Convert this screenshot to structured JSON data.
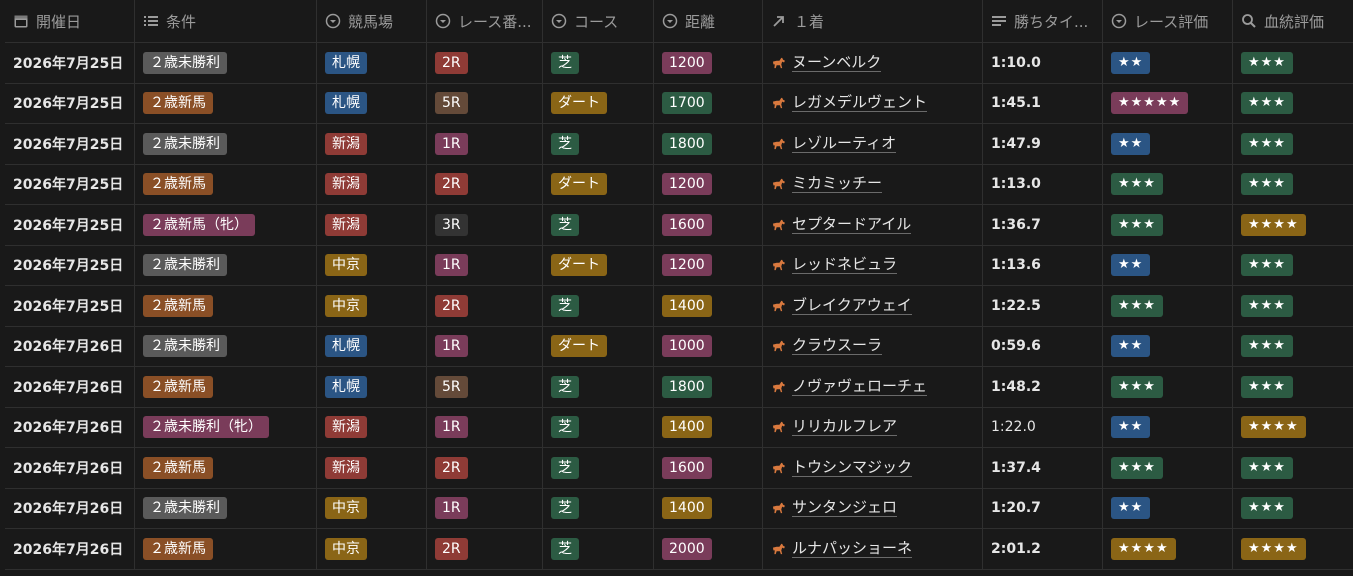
{
  "columns": [
    {
      "label": "開催日",
      "icon": "calendar-icon"
    },
    {
      "label": "条件",
      "icon": "list-icon"
    },
    {
      "label": "競馬場",
      "icon": "select-icon"
    },
    {
      "label": "レース番...",
      "icon": "select-icon"
    },
    {
      "label": "コース",
      "icon": "select-icon"
    },
    {
      "label": "距離",
      "icon": "select-icon"
    },
    {
      "label": "１着",
      "icon": "relation-arrow-icon"
    },
    {
      "label": "勝ちタイ...",
      "icon": "text-lines-icon"
    },
    {
      "label": "レース評価",
      "icon": "select-icon"
    },
    {
      "label": "血統評価",
      "icon": "search-icon"
    }
  ],
  "colors": {
    "background": "#191919",
    "border": "#2f2f2f",
    "gray": "#5a5a5a",
    "orange": "#8a4f26",
    "pink": "#7a3c5a",
    "blue": "#2b5584",
    "red": "#8f3b36",
    "yellow": "#8a6516",
    "brown": "#644a39",
    "dark": "#333333",
    "purple": "#6a3f73",
    "green": "#2c5b43"
  },
  "rows": [
    {
      "date": "2026年7月25日",
      "cond": "２歳未勝利",
      "condColor": "gray",
      "venue": "札幌",
      "venueColor": "blue",
      "race": "2R",
      "raceColor": "red",
      "course": "芝",
      "courseColor": "green",
      "dist": "1200",
      "distColor": "pink",
      "winner": "ヌーンベルク",
      "time": "1:10.0",
      "timeBold": true,
      "raceEval": "★★",
      "raceEvalColor": "blue",
      "bloodEval": "★★★",
      "bloodEvalColor": "green"
    },
    {
      "date": "2026年7月25日",
      "cond": "２歳新馬",
      "condColor": "orange",
      "venue": "札幌",
      "venueColor": "blue",
      "race": "5R",
      "raceColor": "brown",
      "course": "ダート",
      "courseColor": "yellow",
      "dist": "1700",
      "distColor": "green",
      "winner": "レガメデルヴェント",
      "time": "1:45.1",
      "timeBold": true,
      "raceEval": "★★★★★",
      "raceEvalColor": "pink",
      "bloodEval": "★★★",
      "bloodEvalColor": "green"
    },
    {
      "date": "2026年7月25日",
      "cond": "２歳未勝利",
      "condColor": "gray",
      "venue": "新潟",
      "venueColor": "red",
      "race": "1R",
      "raceColor": "pink",
      "course": "芝",
      "courseColor": "green",
      "dist": "1800",
      "distColor": "green",
      "winner": "レゾルーティオ",
      "time": "1:47.9",
      "timeBold": true,
      "raceEval": "★★",
      "raceEvalColor": "blue",
      "bloodEval": "★★★",
      "bloodEvalColor": "green"
    },
    {
      "date": "2026年7月25日",
      "cond": "２歳新馬",
      "condColor": "orange",
      "venue": "新潟",
      "venueColor": "red",
      "race": "2R",
      "raceColor": "red",
      "course": "ダート",
      "courseColor": "yellow",
      "dist": "1200",
      "distColor": "pink",
      "winner": "ミカミッチー",
      "time": "1:13.0",
      "timeBold": true,
      "raceEval": "★★★",
      "raceEvalColor": "green",
      "bloodEval": "★★★",
      "bloodEvalColor": "green"
    },
    {
      "date": "2026年7月25日",
      "cond": "２歳新馬（牝）",
      "condColor": "pink",
      "venue": "新潟",
      "venueColor": "red",
      "race": "3R",
      "raceColor": "dark",
      "course": "芝",
      "courseColor": "green",
      "dist": "1600",
      "distColor": "pink",
      "winner": "セプタードアイル",
      "time": "1:36.7",
      "timeBold": true,
      "raceEval": "★★★",
      "raceEvalColor": "green",
      "bloodEval": "★★★★",
      "bloodEvalColor": "yellow"
    },
    {
      "date": "2026年7月25日",
      "cond": "２歳未勝利",
      "condColor": "gray",
      "venue": "中京",
      "venueColor": "yellow",
      "race": "1R",
      "raceColor": "pink",
      "course": "ダート",
      "courseColor": "yellow",
      "dist": "1200",
      "distColor": "pink",
      "winner": "レッドネビュラ",
      "time": "1:13.6",
      "timeBold": true,
      "raceEval": "★★",
      "raceEvalColor": "blue",
      "bloodEval": "★★★",
      "bloodEvalColor": "green"
    },
    {
      "date": "2026年7月25日",
      "cond": "２歳新馬",
      "condColor": "orange",
      "venue": "中京",
      "venueColor": "yellow",
      "race": "2R",
      "raceColor": "red",
      "course": "芝",
      "courseColor": "green",
      "dist": "1400",
      "distColor": "yellow",
      "winner": "ブレイクアウェイ",
      "time": "1:22.5",
      "timeBold": true,
      "raceEval": "★★★",
      "raceEvalColor": "green",
      "bloodEval": "★★★",
      "bloodEvalColor": "green"
    },
    {
      "date": "2026年7月26日",
      "cond": "２歳未勝利",
      "condColor": "gray",
      "venue": "札幌",
      "venueColor": "blue",
      "race": "1R",
      "raceColor": "pink",
      "course": "ダート",
      "courseColor": "yellow",
      "dist": "1000",
      "distColor": "pink",
      "winner": "クラウスーラ",
      "time": "0:59.6",
      "timeBold": true,
      "raceEval": "★★",
      "raceEvalColor": "blue",
      "bloodEval": "★★★",
      "bloodEvalColor": "green"
    },
    {
      "date": "2026年7月26日",
      "cond": "２歳新馬",
      "condColor": "orange",
      "venue": "札幌",
      "venueColor": "blue",
      "race": "5R",
      "raceColor": "brown",
      "course": "芝",
      "courseColor": "green",
      "dist": "1800",
      "distColor": "green",
      "winner": "ノヴァヴェローチェ",
      "time": "1:48.2",
      "timeBold": true,
      "raceEval": "★★★",
      "raceEvalColor": "green",
      "bloodEval": "★★★",
      "bloodEvalColor": "green"
    },
    {
      "date": "2026年7月26日",
      "cond": "２歳未勝利（牝）",
      "condColor": "pink",
      "venue": "新潟",
      "venueColor": "red",
      "race": "1R",
      "raceColor": "pink",
      "course": "芝",
      "courseColor": "green",
      "dist": "1400",
      "distColor": "yellow",
      "winner": "リリカルフレア",
      "time": "1:22.0",
      "timeBold": false,
      "raceEval": "★★",
      "raceEvalColor": "blue",
      "bloodEval": "★★★★",
      "bloodEvalColor": "yellow"
    },
    {
      "date": "2026年7月26日",
      "cond": "２歳新馬",
      "condColor": "orange",
      "venue": "新潟",
      "venueColor": "red",
      "race": "2R",
      "raceColor": "red",
      "course": "芝",
      "courseColor": "green",
      "dist": "1600",
      "distColor": "pink",
      "winner": "トウシンマジック",
      "time": "1:37.4",
      "timeBold": true,
      "raceEval": "★★★",
      "raceEvalColor": "green",
      "bloodEval": "★★★",
      "bloodEvalColor": "green"
    },
    {
      "date": "2026年7月26日",
      "cond": "２歳未勝利",
      "condColor": "gray",
      "venue": "中京",
      "venueColor": "yellow",
      "race": "1R",
      "raceColor": "pink",
      "course": "芝",
      "courseColor": "green",
      "dist": "1400",
      "distColor": "yellow",
      "winner": "サンタンジェロ",
      "time": "1:20.7",
      "timeBold": true,
      "raceEval": "★★",
      "raceEvalColor": "blue",
      "bloodEval": "★★★",
      "bloodEvalColor": "green"
    },
    {
      "date": "2026年7月26日",
      "cond": "２歳新馬",
      "condColor": "orange",
      "venue": "中京",
      "venueColor": "yellow",
      "race": "2R",
      "raceColor": "red",
      "course": "芝",
      "courseColor": "green",
      "dist": "2000",
      "distColor": "pink",
      "winner": "ルナパッショーネ",
      "time": "2:01.2",
      "timeBold": true,
      "raceEval": "★★★★",
      "raceEvalColor": "yellow",
      "bloodEval": "★★★★",
      "bloodEvalColor": "yellow"
    }
  ]
}
